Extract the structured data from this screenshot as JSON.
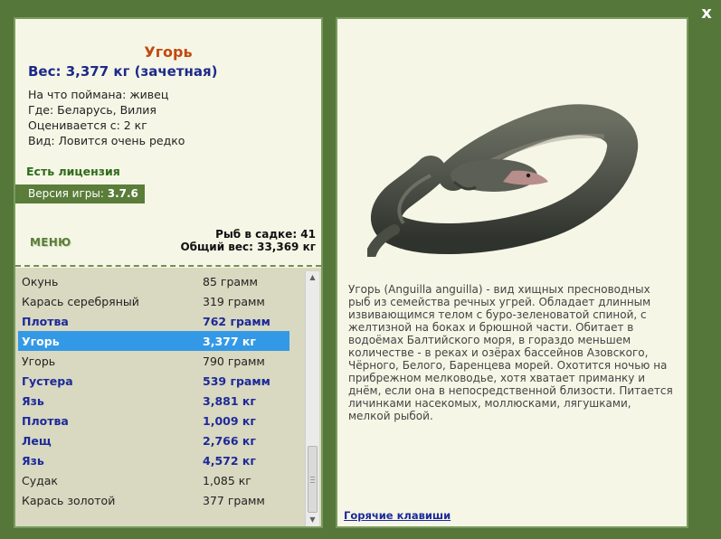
{
  "window": {
    "close_glyph": "x"
  },
  "fish": {
    "name": "Угорь",
    "weight": "Вес: 3,377 кг (зачетная)",
    "bait": "На что поймана: живец",
    "location": "Где: Беларусь, Вилия",
    "value": "Оценивается с: 2 кг",
    "rarity": "Вид: Ловится очень редко"
  },
  "license": "Есть лицензия",
  "version": {
    "label": "Версия игры:",
    "number": "3.7.6"
  },
  "menu_label": "МЕНЮ",
  "keepnet": {
    "count": "Рыб в садке: 41",
    "total_weight": "Общий вес: 33,369 кг"
  },
  "catch_list": [
    {
      "name": "Окунь",
      "weight": "85 грамм",
      "trophy": false
    },
    {
      "name": "Карась серебряный",
      "weight": "319 грамм",
      "trophy": false
    },
    {
      "name": "Плотва",
      "weight": "762 грамм",
      "trophy": true
    },
    {
      "name": "Угорь",
      "weight": "3,377 кг",
      "trophy": true,
      "selected": true
    },
    {
      "name": "Угорь",
      "weight": "790 грамм",
      "trophy": false
    },
    {
      "name": "Густера",
      "weight": "539 грамм",
      "trophy": true
    },
    {
      "name": "Язь",
      "weight": "3,881 кг",
      "trophy": true
    },
    {
      "name": "Плотва",
      "weight": "1,009 кг",
      "trophy": true
    },
    {
      "name": "Лещ",
      "weight": "2,766 кг",
      "trophy": true
    },
    {
      "name": "Язь",
      "weight": "4,572 кг",
      "trophy": true
    },
    {
      "name": "Судак",
      "weight": "1,085 кг",
      "trophy": false
    },
    {
      "name": "Карась золотой",
      "weight": "377 грамм",
      "trophy": false
    }
  ],
  "description": "Угорь (Anguilla anguilla) - вид хищных пресноводных рыб из семейства речных угрей. Обладает длинным извивающимся телом с буро-зеленоватой спиной, с желтизной на боках и брюшной части. Обитает в водоёмах Балтийского моря, в гораздо меньшем количестве - в реках и озёрах бассейнов Азовского, Чёрного, Белого, Баренцева морей. Охотится ночью на прибрежном мелководье, хотя хватает приманку и днём, если она в непосредственной близости. Питается личинками насекомых, моллюсками, лягушками, мелкой рыбой.",
  "hotkeys_label": "Горячие клавиши",
  "colors": {
    "frame_green": "#55773a",
    "panel_bg": "#f6f6e6",
    "list_bg": "#d9d8c0",
    "title_orange": "#c04a10",
    "trophy_blue": "#1c2a9a",
    "selection_blue": "#3399e6",
    "license_green": "#2e6b1a"
  },
  "icons": {
    "close": "close-icon",
    "scroll_up": "arrow-up-icon",
    "scroll_down": "arrow-down-icon"
  }
}
